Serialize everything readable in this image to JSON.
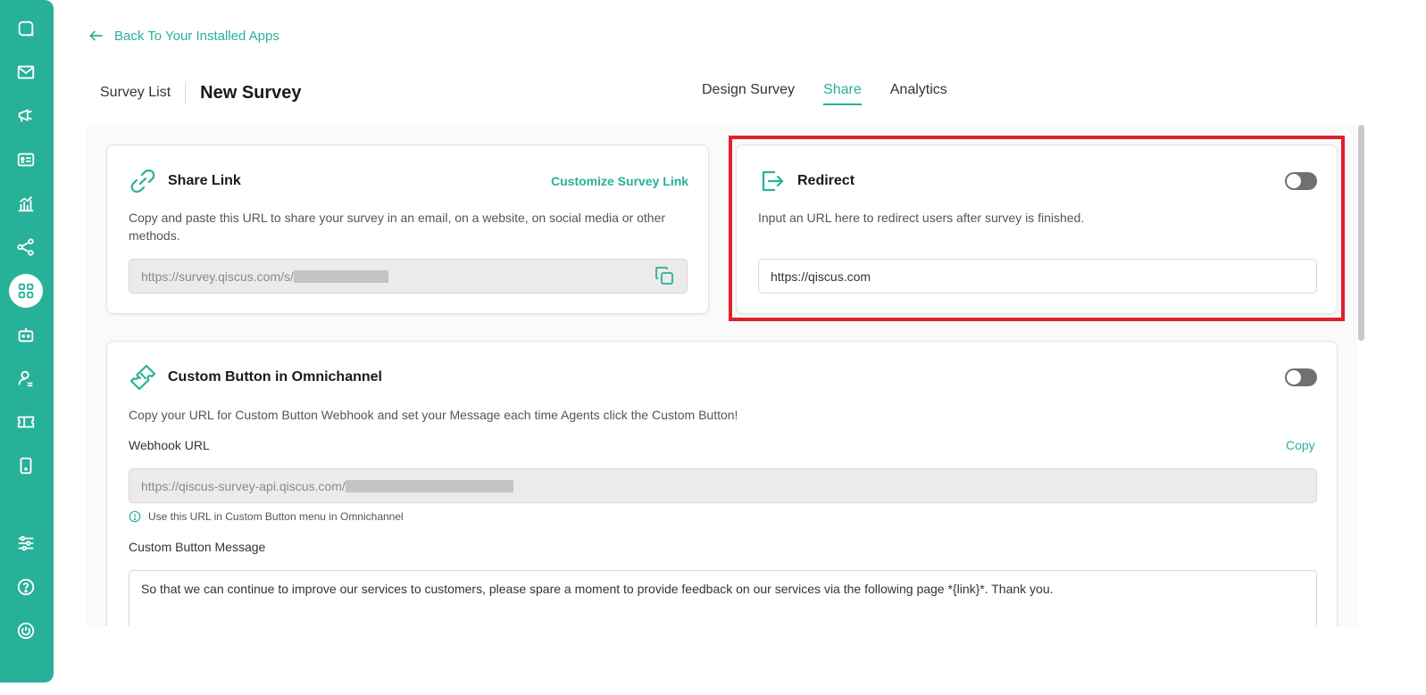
{
  "nav": {
    "back_label": "Back To Your Installed Apps"
  },
  "sidebar": {
    "icons": [
      "chat-icon",
      "mail-icon",
      "megaphone-icon",
      "contact-card-icon",
      "analytics-icon",
      "share-network-icon",
      "apps-grid-icon",
      "bot-icon",
      "agent-icon",
      "ticket-icon",
      "mobile-icon",
      "settings-sliders-icon",
      "help-icon",
      "power-icon"
    ],
    "active": "apps-grid-icon",
    "accent_color": "#27b199"
  },
  "header": {
    "survey_list_label": "Survey List",
    "title": "New Survey",
    "tabs": [
      {
        "label": "Design Survey",
        "active": false
      },
      {
        "label": "Share",
        "active": true
      },
      {
        "label": "Analytics",
        "active": false
      }
    ]
  },
  "share_link": {
    "title": "Share Link",
    "customize_label": "Customize Survey Link",
    "description": "Copy and paste this URL to share your survey in an email, on a website, on social media or other methods.",
    "url": "https://survey.qiscus.com/s/"
  },
  "redirect": {
    "title": "Redirect",
    "description": "Input an URL here to redirect users after survey is finished.",
    "url_value": "https://qiscus.com",
    "enabled": false
  },
  "custom_button": {
    "title": "Custom Button in Omnichannel",
    "description": "Copy your URL for Custom Button Webhook and set your Message each time Agents click the Custom Button!",
    "webhook_label": "Webhook URL",
    "copy_label": "Copy",
    "webhook_url": "https://qiscus-survey-api.qiscus.com/",
    "hint": "Use this URL in Custom Button menu in Omnichannel",
    "message_label": "Custom Button Message",
    "message": "So that we can continue to improve our services to customers, please spare a moment to provide feedback on our services via the following page *{link}*. Thank you.",
    "enabled": false
  },
  "colors": {
    "accent": "#27b199",
    "highlight": "#e0202a"
  }
}
